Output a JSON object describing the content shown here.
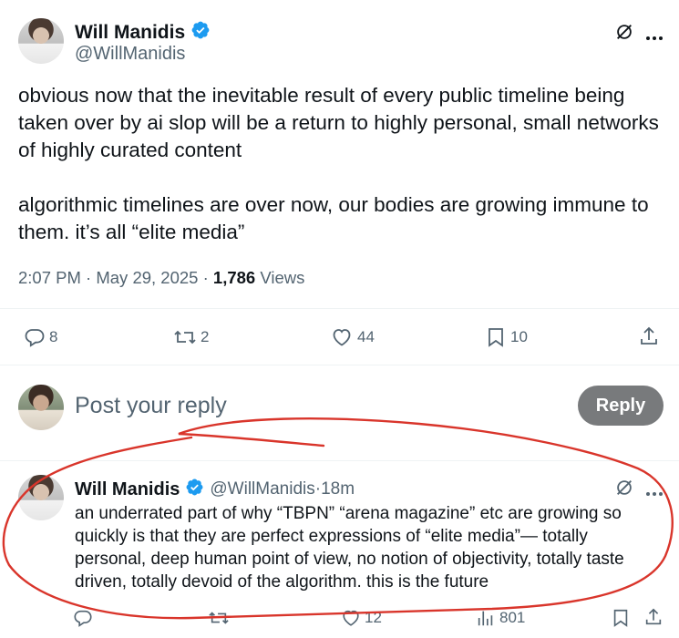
{
  "tweet": {
    "author_name": "Will Manidis",
    "author_handle": "@WillManidis",
    "text": "obvious now that the inevitable result of every public timeline being taken over by ai slop will be a return to highly personal, small networks of highly curated content\n\nalgorithmic timelines are over now, our bodies are growing immune to them. it’s all “elite media”",
    "time": "2:07 PM",
    "separator1": " · ",
    "date": "May 29, 2025",
    "separator2": " · ",
    "views_count": "1,786",
    "views_label": " Views",
    "actions": {
      "replies": "8",
      "reposts": "2",
      "likes": "44",
      "bookmarks": "10"
    }
  },
  "compose": {
    "placeholder": "Post your reply",
    "button_label": "Reply"
  },
  "reply": {
    "author_name": "Will Manidis",
    "author_handle": "@WillManidis",
    "separator": " · ",
    "time_ago": "18m",
    "text": "an underrated part of why “TBPN” “arena magazine” etc are growing so quickly is that they are perfect expressions of “elite media”— totally personal, deep human point of view, no notion of objectivity, totally taste driven, totally devoid of the algorithm. this is the future",
    "actions": {
      "likes": "12",
      "views": "801"
    }
  },
  "icons": {
    "verified": "verified-badge-icon",
    "grok": "grok-icon",
    "more": "more-icon",
    "reply": "reply-icon",
    "repost": "repost-icon",
    "like": "like-icon",
    "bookmark": "bookmark-icon",
    "share": "share-icon",
    "views": "views-icon"
  },
  "colors": {
    "verified": "#1d9bf0",
    "text": "#0f1419",
    "secondary": "#536471",
    "reply_button": "#787a7c",
    "annotation_circle": "#d9352b"
  }
}
